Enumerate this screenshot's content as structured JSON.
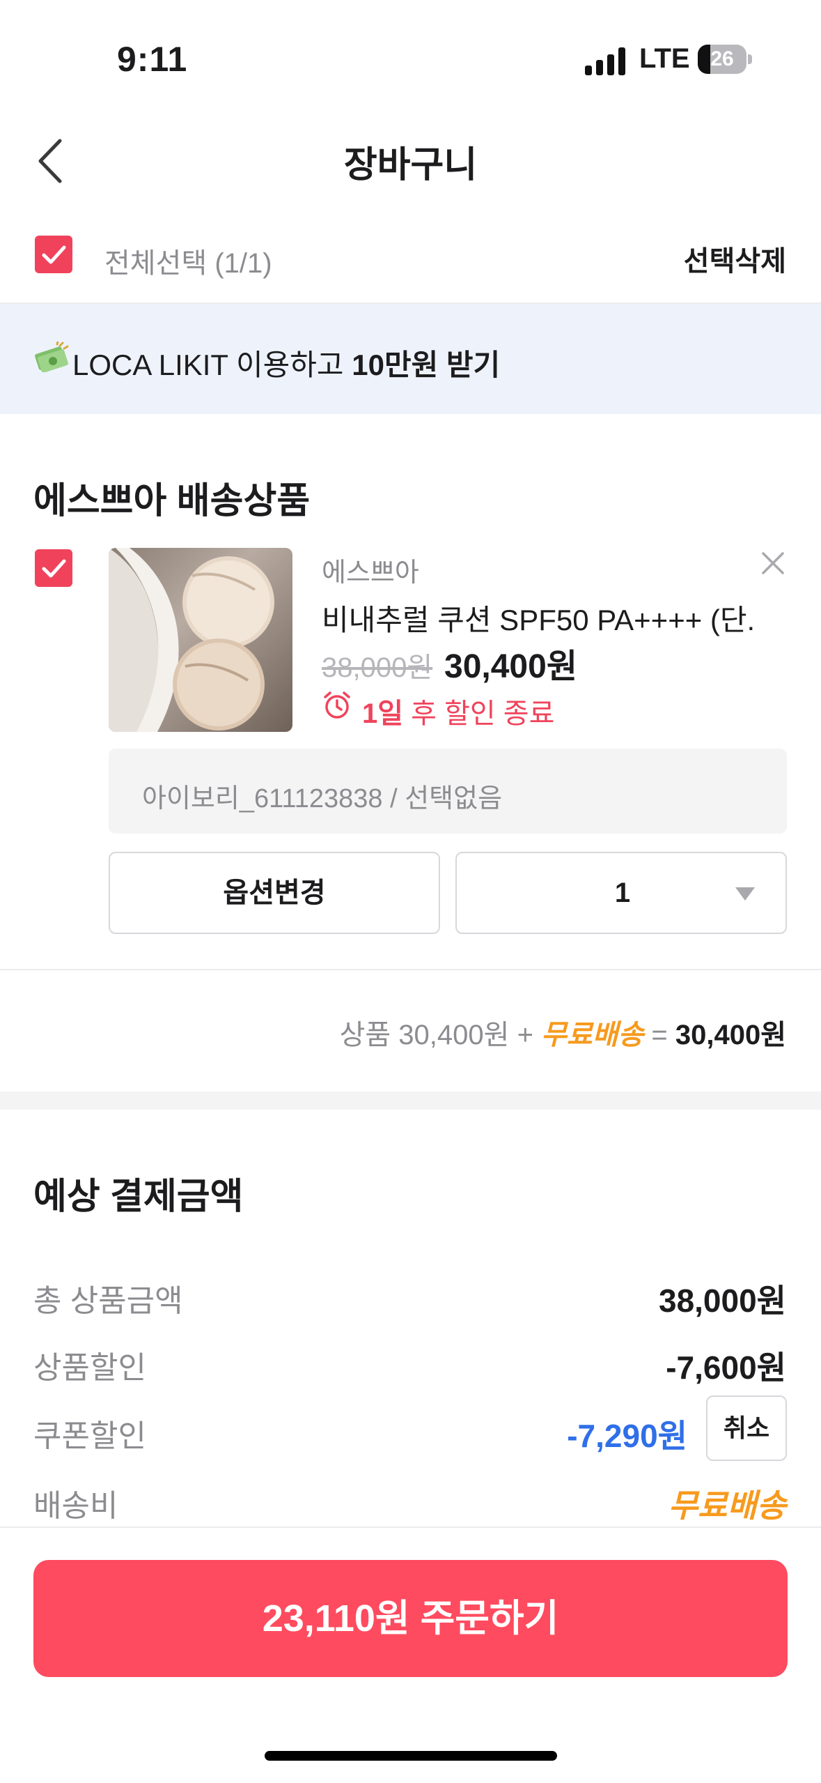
{
  "status_bar": {
    "time": "9:11",
    "network": "LTE",
    "battery": "26",
    "battery_level": 0.26
  },
  "header": {
    "title": "장바구니"
  },
  "select_bar": {
    "select_all": "전체선택 (1/1)",
    "delete_selected": "선택삭제"
  },
  "banner": {
    "text_prefix": "LOCA LIKIT 이용하고 ",
    "text_bold": "10만원 받기",
    "icon": "money-icon"
  },
  "shipping_group": {
    "title": "에스쁘아 배송상품",
    "item": {
      "brand": "에스쁘아",
      "name": "비내추럴 쿠션 SPF50 PA++++ (단...",
      "original_price": "38,000원",
      "sale_price": "30,400원",
      "timer_bold": "1일",
      "timer_rest": " 후 할인 종료",
      "option": "아이보리_611123838 / 선택없음",
      "option_change": "옵션변경",
      "quantity": "1"
    },
    "subtotal": {
      "product": "상품 30,400원 + ",
      "free_shipping": "무료배송",
      "equals": " = ",
      "total": "30,400원"
    }
  },
  "payment_summary": {
    "title": "예상 결제금액",
    "rows": [
      {
        "label": "총 상품금액",
        "value": "38,000원"
      },
      {
        "label": "상품할인",
        "value": "-7,600원"
      },
      {
        "label": "쿠폰할인",
        "value": "-7,290원",
        "action": "취소"
      },
      {
        "label": "배송비",
        "value": "무료배송"
      }
    ]
  },
  "order_button": {
    "label": "23,110원 주문하기"
  },
  "colors": {
    "accent": "#f0435b",
    "order": "#ff4b5f",
    "free_shipping": "#f79a1e",
    "coupon": "#2f6fe8",
    "banner_bg": "#eef3fb"
  }
}
